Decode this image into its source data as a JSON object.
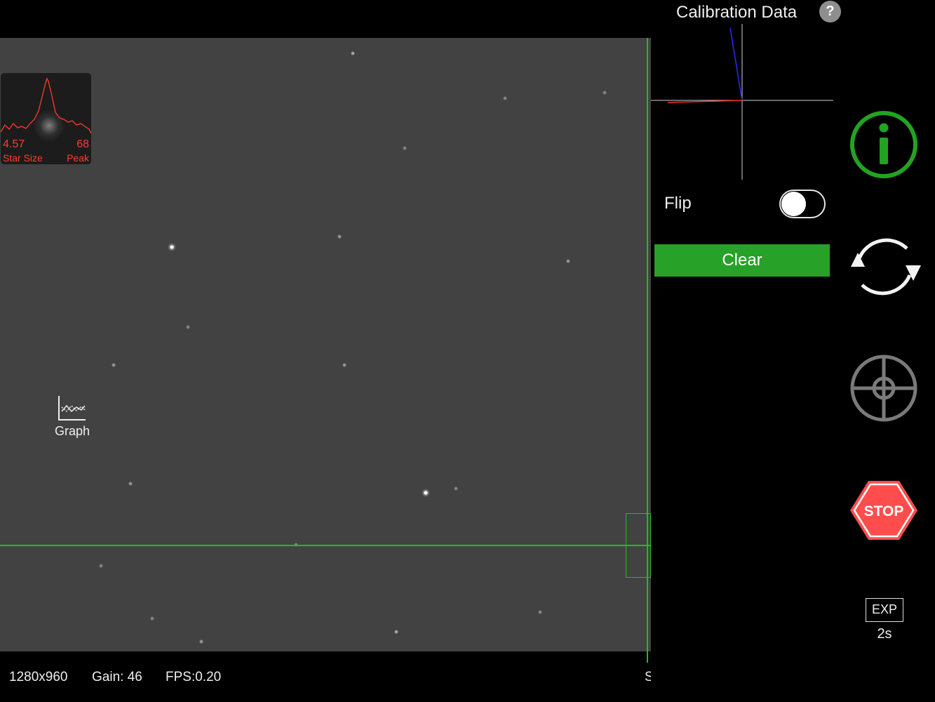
{
  "star_profile": {
    "size_value": "4.57",
    "size_label": "Star Size",
    "peak_value": "68",
    "peak_label": "Peak"
  },
  "graph": {
    "label": "Graph"
  },
  "status": {
    "resolution": "1280x960",
    "gain": "Gain: 46",
    "fps": "FPS:0.20",
    "clipped": "S"
  },
  "calibration": {
    "title": "Calibration Data",
    "help": "?"
  },
  "flip": {
    "label": "Flip",
    "enabled": false
  },
  "clear_button": {
    "label": "Clear"
  },
  "stop_button": {
    "label": "STOP"
  },
  "exposure": {
    "label": "EXP",
    "value": "2s"
  },
  "colors": {
    "guide_green": "#18c218",
    "clear_green": "#27a127",
    "info_green": "#22a322",
    "stop_red": "#ff3b30",
    "profile_red": "#ff3b30"
  }
}
